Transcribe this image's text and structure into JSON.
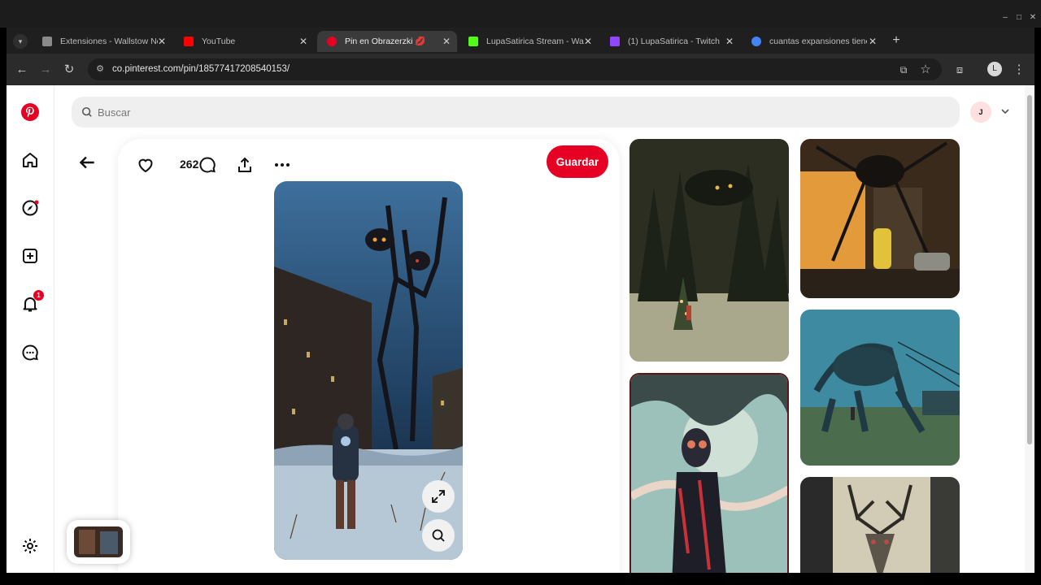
{
  "browser": {
    "tabs": [
      {
        "label": "Extensiones - Wallstow Ne",
        "favicon": "puzzle-icon",
        "color": "#8a8a8a"
      },
      {
        "label": "YouTube",
        "favicon": "youtube-icon",
        "color": "#ff0000"
      },
      {
        "label": "Pin en Obrazerzki 💋",
        "favicon": "pinterest-icon",
        "color": "#e60023"
      },
      {
        "label": "LupaSatirica Stream - Wall",
        "favicon": "kick-icon",
        "color": "#53fc18"
      },
      {
        "label": "(1) LupaSatirica - Twitch",
        "favicon": "twitch-icon",
        "color": "#9146ff"
      },
      {
        "label": "cuantas expansiones tiene",
        "favicon": "google-icon",
        "color": "#4285f4"
      }
    ],
    "new_tab": "+",
    "url": "co.pinterest.com/pin/1857741720854015​3/",
    "profile_initial": "L"
  },
  "page": {
    "search_placeholder": "Buscar",
    "user_initial": "J",
    "notification_count": "1",
    "pin": {
      "like_count": "262",
      "save_label": "Guardar"
    }
  },
  "colors": {
    "brand": "#e60023"
  }
}
